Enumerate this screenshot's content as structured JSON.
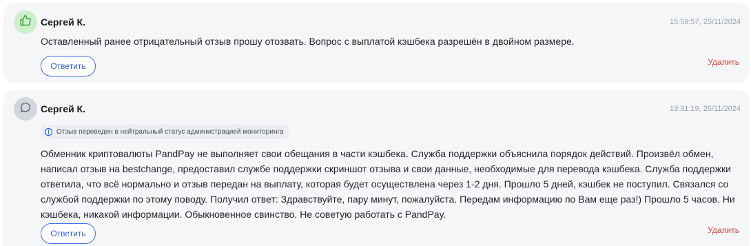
{
  "reviews": [
    {
      "author": "Сергей К.",
      "timestamp": "15:59:57, 25/11/2024",
      "avatar_icon": "thumbs-up-icon",
      "text": "Оставленный ранее отрицательный отзыв прошу отозвать. Вопрос с выплатой кэшбека разрешён в двойном размере.",
      "reply_label": "Ответить",
      "delete_label": "Удалить"
    },
    {
      "author": "Сергей К.",
      "timestamp": "13:31:19, 25/11/2024",
      "avatar_icon": "chat-bubble-icon",
      "status_note": "Отзыв переведен в нейтральный статус администрацией мониторинга",
      "text": "Обменник криптовалюты PandPay не выполняет свои обещания в части кэшбека. Служба поддержки объяснила порядок действий. Произвёл обмен, написал отзыв на bestchange, предоставил службе поддержки скриншот отзыва и свои данные, необходимые для перевода кэшбека. Служба поддержки ответила, что всё нормально и отзыв передан на выплату, которая будет осуществлена через 1-2 дня. Прошло 5 дней, кэшбек не поступил. Связался со службой поддержки по этому поводу. Получил ответ: Здравствуйте, пару минут, пожалуйста. Передам информацию по Вам еще раз!) Прошло 5 часов. Ни кэшбека, никакой информации. Обыкновенное свинство. Не советую работать с PandPay.",
      "reply_label": "Ответить",
      "delete_label": "Удалить"
    }
  ],
  "colors": {
    "positive_avatar_bg": "#cfeecd",
    "positive_icon": "#3aa63a",
    "neutral_avatar_bg": "#d3d6dc",
    "neutral_icon": "#5b6068",
    "accent": "#2f5fd8",
    "delete": "#e0433a",
    "card_bg": "#f5f6f8"
  }
}
